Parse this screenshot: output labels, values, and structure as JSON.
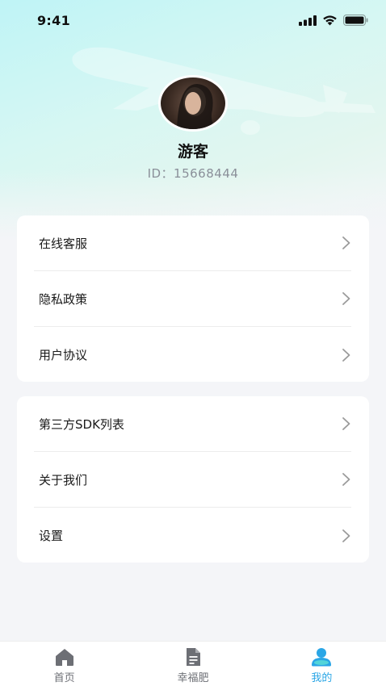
{
  "status_bar": {
    "time": "9:41",
    "icons": [
      "signal-icon",
      "wifi-icon",
      "battery-icon"
    ]
  },
  "profile": {
    "username": "游客",
    "id_text": "ID：15668444"
  },
  "menu_group_1": {
    "items": [
      {
        "label": "在线客服",
        "icon": "chevron-right-icon"
      },
      {
        "label": "隐私政策",
        "icon": "chevron-right-icon"
      },
      {
        "label": "用户协议",
        "icon": "chevron-right-icon"
      }
    ]
  },
  "menu_group_2": {
    "items": [
      {
        "label": "第三方SDK列表",
        "icon": "chevron-right-icon"
      },
      {
        "label": "关于我们",
        "icon": "chevron-right-icon"
      },
      {
        "label": "设置",
        "icon": "chevron-right-icon"
      }
    ]
  },
  "tab_bar": {
    "tabs": [
      {
        "label": "首页",
        "icon": "home-icon",
        "active": false
      },
      {
        "label": "幸福肥",
        "icon": "document-icon",
        "active": false
      },
      {
        "label": "我的",
        "icon": "user-icon",
        "active": true
      }
    ]
  },
  "colors": {
    "accent": "#2aa6e6",
    "inactive_tab": "#6d6f75",
    "background": "#f4f5f8",
    "hero_gradient_start": "#bff4f6"
  }
}
